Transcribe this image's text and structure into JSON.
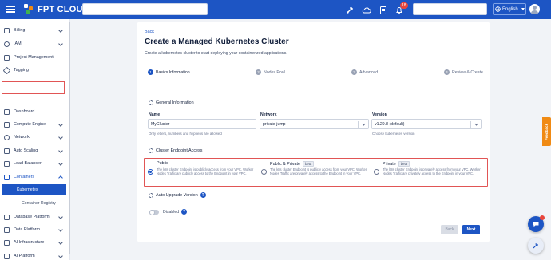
{
  "brand": {
    "logo_text": "FPT CLOUD",
    "accent": "#1d55c4"
  },
  "topbar": {
    "notifications_count": "18",
    "language": "English",
    "icons": [
      "menu-icon",
      "rocket-icon",
      "cloud-upload-icon",
      "document-icon",
      "bell-icon",
      "globe-icon",
      "avatar"
    ]
  },
  "sidebar": {
    "items": [
      {
        "label": "Billing"
      },
      {
        "label": "IAM"
      },
      {
        "label": "Project Management"
      },
      {
        "label": "Tagging"
      },
      {
        "label": "Dashboard"
      },
      {
        "label": "Compute Engine"
      },
      {
        "label": "Network"
      },
      {
        "label": "Auto Scaling"
      },
      {
        "label": "Load Balancer"
      },
      {
        "label": "Containers"
      },
      {
        "label": "Kubernetes"
      },
      {
        "label": "Container Registry"
      },
      {
        "label": "Database Platform"
      },
      {
        "label": "Data Platform"
      },
      {
        "label": "AI Infrastructure"
      },
      {
        "label": "AI Platform"
      }
    ]
  },
  "page": {
    "back_label": "Back",
    "title": "Create a Managed Kubernetes Cluster",
    "subtitle": "Create a kubernetes cluster to start deploying your containerized applications.",
    "steps": [
      {
        "num": "1",
        "label": "Basics Information"
      },
      {
        "num": "2",
        "label": "Nodes Pool"
      },
      {
        "num": "3",
        "label": "Advanced"
      },
      {
        "num": "4",
        "label": "Review & Create"
      }
    ]
  },
  "general": {
    "section_title": "General Information",
    "name_label": "Name",
    "name_value": "MyCluster",
    "name_hint": "Only letters, numbers and hyphens are allowed",
    "network_label": "Network",
    "network_value": "private-jump",
    "version_label": "Version",
    "version_value": "v1.29.8 (default)",
    "version_hint": "Choose kubernetes version"
  },
  "endpoint": {
    "section_title": "Cluster Endpoint Access",
    "selected": "Public",
    "options": [
      {
        "title": "Public",
        "beta": "",
        "desc": "The k8s cluster Endpoint is publicly access from your VPC. Worker Nodes Traffic are publicly access to the Endpoint in your VPC."
      },
      {
        "title": "Public & Private",
        "beta": "beta",
        "desc": "The k8s cluster Endpoint is publicly access from your VPC. Worker Nodes Traffic are privately access to the Endpoint in your VPC."
      },
      {
        "title": "Private",
        "beta": "beta",
        "desc": "The k8s cluster Endpoint is privately access from your VPC. Worker Nodes Traffic are privately access to the Endpoint in your VPC."
      }
    ]
  },
  "auto_upgrade": {
    "section_title": "Auto Upgrade Version",
    "toggle_state": "Disabled",
    "help_glyph": "?"
  },
  "actions": {
    "back_label": "Back",
    "next_label": "Next"
  },
  "feedback_label": "Feedback"
}
